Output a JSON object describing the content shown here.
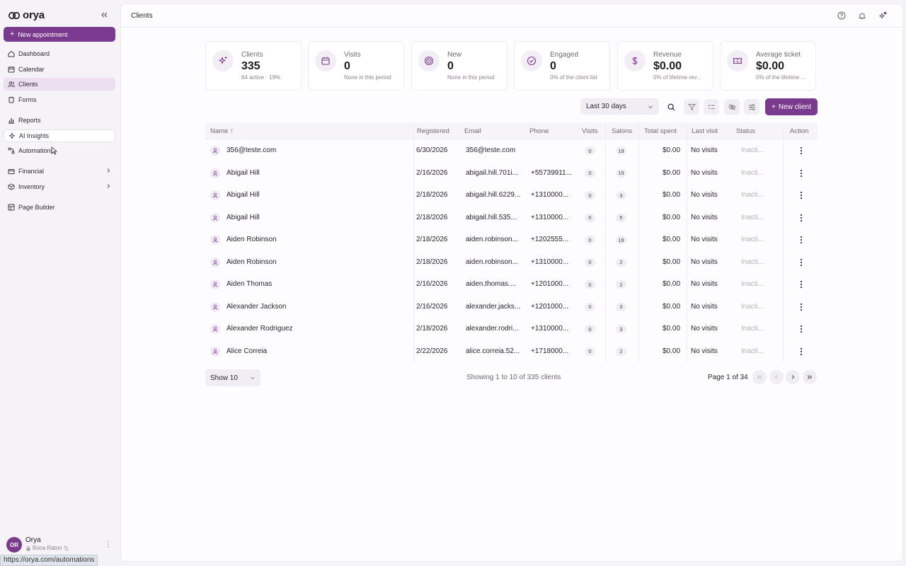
{
  "brand": {
    "name": "orya"
  },
  "sidebar": {
    "new_appointment": "New appointment",
    "items": [
      {
        "label": "Dashboard",
        "icon": "house-icon"
      },
      {
        "label": "Calendar",
        "icon": "calendar-icon"
      },
      {
        "label": "Clients",
        "icon": "users-icon"
      },
      {
        "label": "Forms",
        "icon": "clipboard-icon"
      },
      {
        "label": "Reports",
        "icon": "bar-chart-icon"
      },
      {
        "label": "AI Insights",
        "icon": "sparkle-icon"
      },
      {
        "label": "Automations",
        "icon": "workflow-icon"
      },
      {
        "label": "Financial",
        "icon": "wallet-icon"
      },
      {
        "label": "Inventory",
        "icon": "box-icon"
      },
      {
        "label": "Page Builder",
        "icon": "layout-icon"
      }
    ],
    "active": "Clients",
    "hovered": "AI Insights"
  },
  "user": {
    "initials": "OR",
    "name": "Orya",
    "location": "Boca Raton"
  },
  "status_url": "https://orya.com/automations",
  "header": {
    "title": "Clients"
  },
  "stats": [
    {
      "label": "Clients",
      "value": "335",
      "sub": "64 active · 19%"
    },
    {
      "label": "Visits",
      "value": "0",
      "sub": "None in this period"
    },
    {
      "label": "New",
      "value": "0",
      "sub": "None in this period"
    },
    {
      "label": "Engaged",
      "value": "0",
      "sub": "0% of the client list"
    },
    {
      "label": "Revenue",
      "value": "$0.00",
      "sub": "0% of lifetime rev..."
    },
    {
      "label": "Average ticket",
      "value": "$0.00",
      "sub": "0% of the lifetime ..."
    }
  ],
  "toolbar": {
    "date_range": "Last 30 days",
    "new_client": "New client"
  },
  "table": {
    "headers": [
      "Name ↑",
      "Registered",
      "Email",
      "Phone",
      "Visits",
      "Salons",
      "Total spent",
      "Last visit",
      "Status",
      "Action"
    ],
    "rows": [
      {
        "name": "356@teste.com",
        "registered": "6/30/2026",
        "email": "356@teste.com",
        "phone": "",
        "visits": "0",
        "salons": "19",
        "spent": "$0.00",
        "last": "No visits",
        "status": "Inacti..."
      },
      {
        "name": "Abigail Hill",
        "registered": "2/16/2026",
        "email": "abigail.hill.701i...",
        "phone": "+55739911...",
        "visits": "0",
        "salons": "19",
        "spent": "$0.00",
        "last": "No visits",
        "status": "Inacti..."
      },
      {
        "name": "Abigail Hill",
        "registered": "2/18/2026",
        "email": "abigail.hill.6229...",
        "phone": "+1310000...",
        "visits": "0",
        "salons": "3",
        "spent": "$0.00",
        "last": "No visits",
        "status": "Inacti..."
      },
      {
        "name": "Abigail Hill",
        "registered": "2/18/2026",
        "email": "abigail.hill.535...",
        "phone": "+1310000...",
        "visits": "0",
        "salons": "5",
        "spent": "$0.00",
        "last": "No visits",
        "status": "Inacti..."
      },
      {
        "name": "Aiden Robinson",
        "registered": "2/18/2026",
        "email": "aiden.robinson...",
        "phone": "+1202555...",
        "visits": "0",
        "salons": "19",
        "spent": "$0.00",
        "last": "No visits",
        "status": "Inacti..."
      },
      {
        "name": "Aiden Robinson",
        "registered": "2/18/2026",
        "email": "aiden.robinson...",
        "phone": "+1310000...",
        "visits": "0",
        "salons": "2",
        "spent": "$0.00",
        "last": "No visits",
        "status": "Inacti..."
      },
      {
        "name": "Aiden Thomas",
        "registered": "2/16/2026",
        "email": "aiden.thomas....",
        "phone": "+1201000...",
        "visits": "0",
        "salons": "2",
        "spent": "$0.00",
        "last": "No visits",
        "status": "Inacti..."
      },
      {
        "name": "Alexander Jackson",
        "registered": "2/16/2026",
        "email": "alexander.jacks...",
        "phone": "+1201000...",
        "visits": "0",
        "salons": "3",
        "spent": "$0.00",
        "last": "No visits",
        "status": "Inacti..."
      },
      {
        "name": "Alexander Rodriguez",
        "registered": "2/18/2026",
        "email": "alexander.rodri...",
        "phone": "+1310000...",
        "visits": "0",
        "salons": "3",
        "spent": "$0.00",
        "last": "No visits",
        "status": "Inacti..."
      },
      {
        "name": "Alice Correia",
        "registered": "2/22/2026",
        "email": "alice.correia.52...",
        "phone": "+1718000...",
        "visits": "0",
        "salons": "2",
        "spent": "$0.00",
        "last": "No visits",
        "status": "Inacti..."
      }
    ]
  },
  "pagination": {
    "show": "Show 10",
    "showing": "Showing 1 to 10 of 335 clients",
    "page": "Page 1 of 34"
  },
  "colors": {
    "accent": "#7a3a8e",
    "sidebar_bg": "#f6f3f8",
    "active_bg": "#ece0f0"
  }
}
